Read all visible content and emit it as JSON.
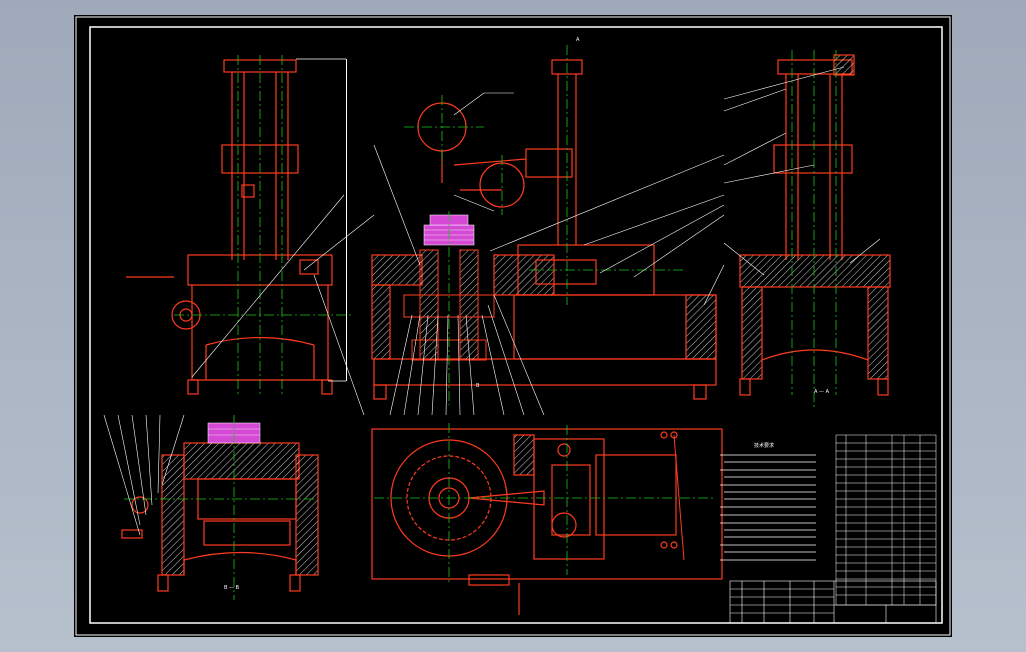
{
  "colors": {
    "background": "#000000",
    "frame": "#ffffff",
    "part_outline": "#ff3b1f",
    "centerline": "#19c419",
    "hatch": "#ffffff",
    "dimension": "#ffffff",
    "highlight_part": "#d54ad5",
    "annotation_text": "#ffff66",
    "outside": "#a7b1c0"
  },
  "views": {
    "section_a_label": "A — A",
    "section_b_label": "B — B",
    "section_mark_a": "A",
    "section_mark_b": "B"
  },
  "notes": {
    "title": "技术要求"
  }
}
